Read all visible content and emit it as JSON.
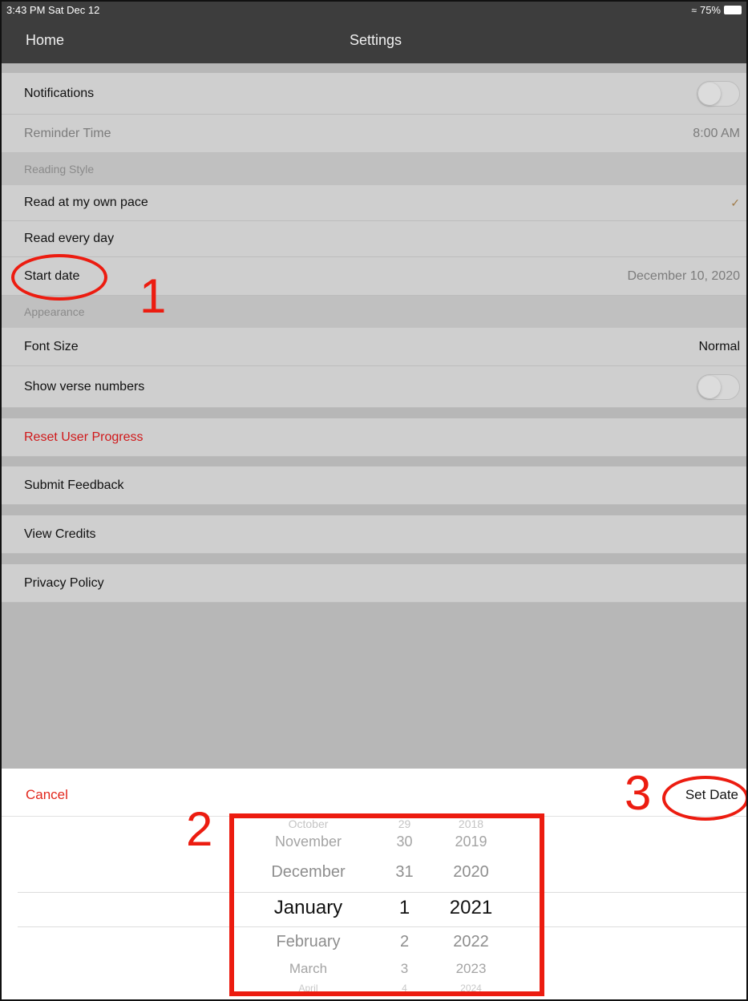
{
  "status_bar": {
    "time": "3:43 PM  Sat Dec 12",
    "battery": "75%"
  },
  "nav": {
    "back_label": "Home",
    "title": "Settings"
  },
  "settings": {
    "notifications_label": "Notifications",
    "reminder_time_label": "Reminder Time",
    "reminder_time_value": "8:00 AM",
    "reading_style_header": "Reading Style",
    "own_pace_label": "Read at my own pace",
    "every_day_label": "Read every day",
    "start_date_label": "Start date",
    "start_date_value": "December 10, 2020",
    "appearance_header": "Appearance",
    "font_size_label": "Font Size",
    "font_size_value": "Normal",
    "show_verse_label": "Show verse numbers",
    "reset_label": "Reset User Progress",
    "feedback_label": "Submit Feedback",
    "credits_label": "View Credits",
    "privacy_label": "Privacy Policy"
  },
  "sheet": {
    "cancel_label": "Cancel",
    "set_date_label": "Set Date"
  },
  "picker": {
    "months": [
      "October",
      "November",
      "December",
      "January",
      "February",
      "March",
      "April"
    ],
    "days": [
      "29",
      "30",
      "31",
      "1",
      "2",
      "3",
      "4"
    ],
    "years": [
      "2018",
      "2019",
      "2020",
      "2021",
      "2022",
      "2023",
      "2024"
    ]
  },
  "annotations": {
    "one": "1",
    "two": "2",
    "three": "3"
  },
  "colors": {
    "annotation": "#ec1c10",
    "destructive": "#d0181a",
    "nav_bar": "#3d3d3d"
  }
}
